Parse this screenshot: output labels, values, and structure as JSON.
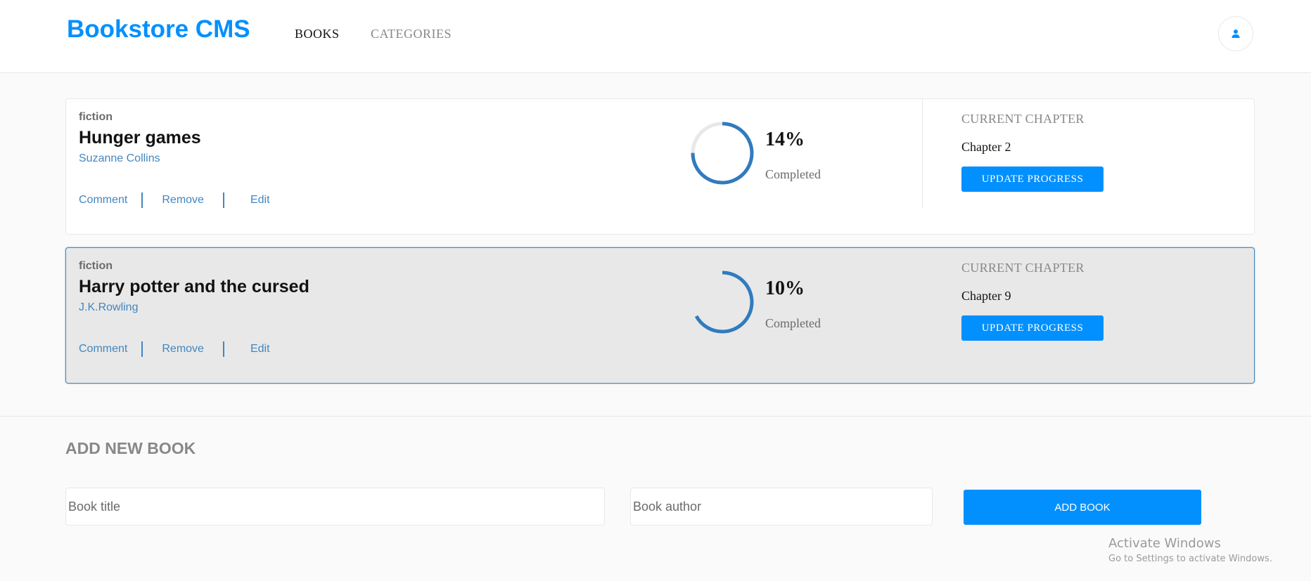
{
  "header": {
    "logo": "Bookstore CMS",
    "nav": [
      {
        "label": "BOOKS"
      },
      {
        "label": "CATEGORIES"
      }
    ],
    "user_icon": "user-icon"
  },
  "books": [
    {
      "genre": "fiction",
      "title": "Hunger games",
      "author": "Suzanne Collins",
      "actions": {
        "comment": "Comment",
        "remove": "Remove",
        "edit": "Edit"
      },
      "progress_percent": 14,
      "percent_label": "14%",
      "completed_label": "Completed",
      "chapter_label": "CURRENT CHAPTER",
      "chapter": "Chapter 2",
      "update_label": "UPDATE PROGRESS",
      "selected": false
    },
    {
      "genre": "fiction",
      "title": "Harry potter and the cursed",
      "author": "J.K.Rowling",
      "actions": {
        "comment": "Comment",
        "remove": "Remove",
        "edit": "Edit"
      },
      "progress_percent": 10,
      "percent_label": "10%",
      "completed_label": "Completed",
      "chapter_label": "CURRENT CHAPTER",
      "chapter": "Chapter 9",
      "update_label": "UPDATE PROGRESS",
      "selected": true
    }
  ],
  "form": {
    "heading": "ADD NEW BOOK",
    "title_placeholder": "Book title",
    "author_placeholder": "Book author",
    "submit_label": "ADD BOOK"
  },
  "watermark": {
    "title": "Activate Windows",
    "subtitle": "Go to Settings to activate Windows."
  },
  "colors": {
    "accent": "#0290ff",
    "link": "#4386bf",
    "ring_track": "#e8e8e8"
  }
}
